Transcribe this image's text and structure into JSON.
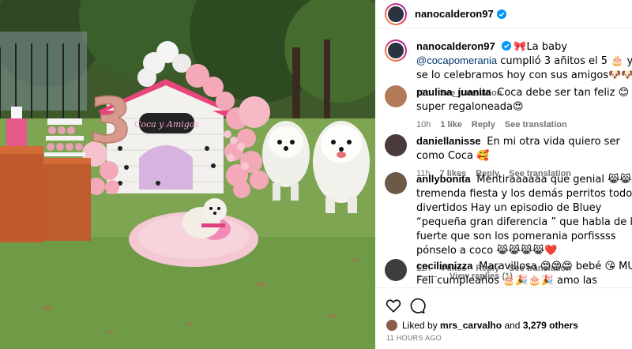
{
  "post": {
    "author": "nanocalderon97"
  },
  "caption": {
    "author": "nanocalderon97",
    "text_before": "🎀La baby ",
    "mention": "@cocapomerania",
    "text_after": " cumplió 3 añitos el 5 🎂 y se lo celebramos hoy con sus amigos🐶🐶",
    "time": "11h",
    "see_translation": "See translation"
  },
  "comments": [
    {
      "author": "paulina_juanita",
      "text": "Coca debe ser tan feliz 😊 Es super regaloneada😍",
      "time": "10h",
      "likes": "1 like",
      "reply": "Reply",
      "see_translation": "See translation"
    },
    {
      "author": "daniellanisse",
      "text": "En mi otra vida quiero ser como Coca 🥰",
      "time": "11h",
      "likes": "7 likes",
      "reply": "Reply",
      "see_translation": "See translation"
    },
    {
      "author": "anllybonita",
      "text": "Mentiraaaaaa que genial 😹😹 tremenda fiesta y los demás perritos todos divertidos Hay un episodio de Bluey “pequeña gran diferencia ” que habla de lo fuerte que son los pomerania porfissss pónselo a coco 😹😹😹😹❤️",
      "time": "11h",
      "likes": "4 likes",
      "reply": "Reply",
      "see_translation": "See translation"
    },
    {
      "author": "cecilianizza",
      "text": "Maravillosa 😍😍😍 bebé 😘 MUY Feli cumpleaños 🎂🎉🎂🎉 amo las personas que aman a su perritos 🎂"
    }
  ],
  "view_replies": "View replies (1)",
  "likes": {
    "prefix": "Liked by",
    "user": "mrs_carvalho",
    "middle": "and",
    "count": "3,279 others"
  },
  "timeago": "11 HOURS AGO",
  "photo": {
    "number_balloon": "3",
    "sign_text": "Coca y Amigos"
  },
  "colors": {
    "link": "#00376b",
    "secondary_text": "#737373",
    "verified": "#0095f6",
    "balloon_pink": "#f4a9b8"
  }
}
